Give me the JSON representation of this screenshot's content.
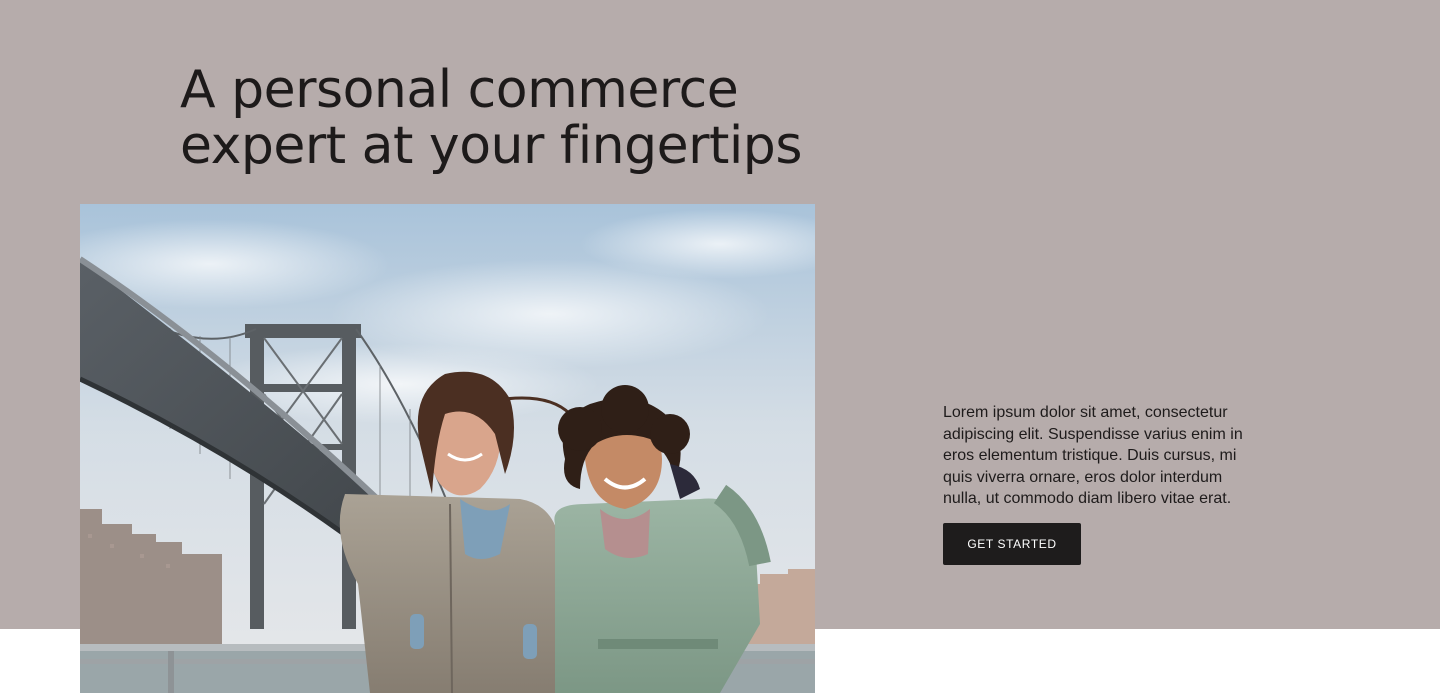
{
  "hero": {
    "heading_line1": "A personal commerce",
    "heading_line2": "expert at your fingertips",
    "body": "Lorem ipsum dolor sit amet, consectetur adipiscing elit. Suspendisse varius enim in eros elementum tristique. Duis cursus, mi quis viverra ornare, eros dolor interdum nulla, ut commodo diam libero vitae erat.",
    "cta_label": "GET STARTED"
  },
  "colors": {
    "hero_background": "#b6acab",
    "text": "#1d1a1a",
    "button_background": "#1e1c1c",
    "button_text": "#ffffff",
    "page_background": "#ffffff"
  },
  "image": {
    "subject": "two smiling women in winter coats by a river with a suspension bridge behind them"
  }
}
